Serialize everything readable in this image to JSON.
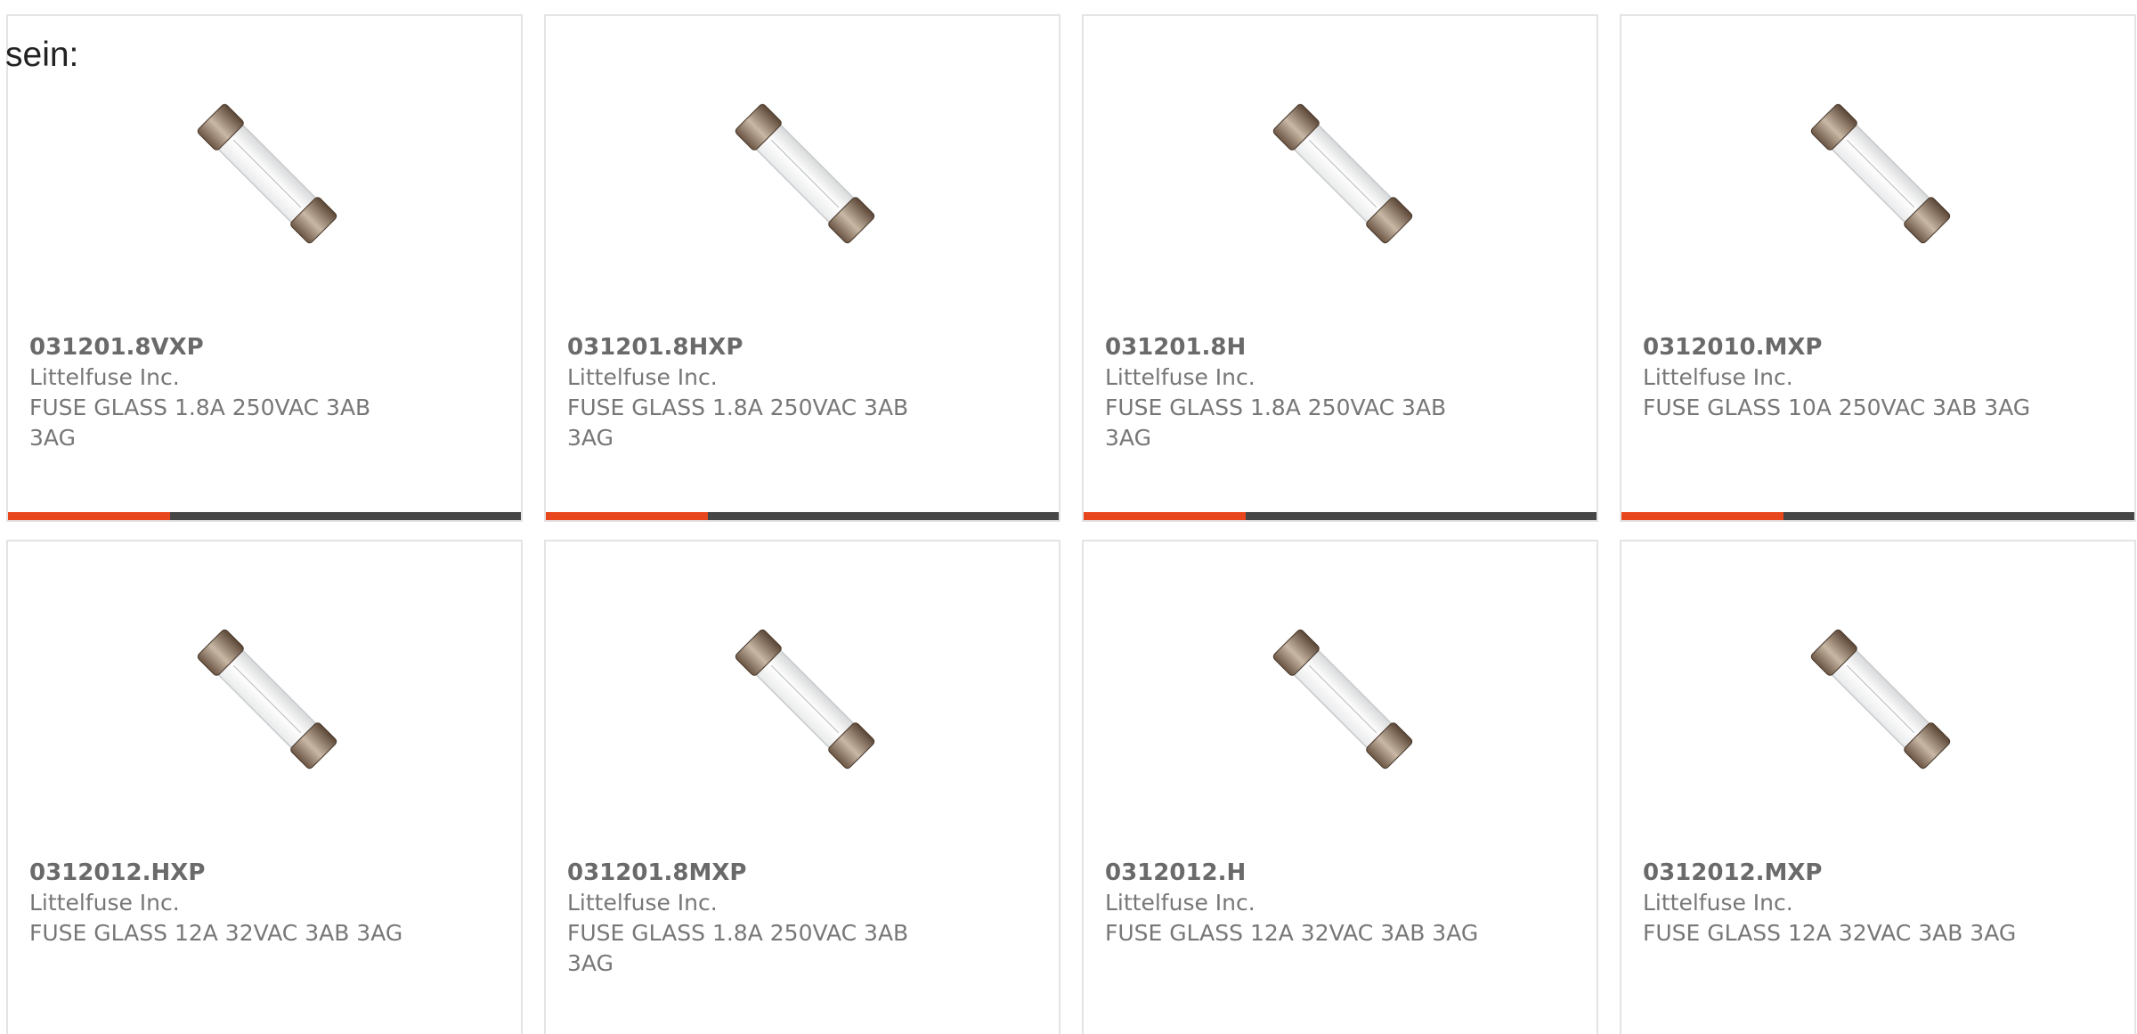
{
  "intro": {
    "label": "sein:"
  },
  "products": [
    {
      "part_number": "031201.8VXP",
      "manufacturer": "Littelfuse Inc.",
      "description": "FUSE GLASS 1.8A 250VAC 3AB 3AG",
      "image_icon": "glass-fuse-icon"
    },
    {
      "part_number": "031201.8HXP",
      "manufacturer": "Littelfuse Inc.",
      "description": "FUSE GLASS 1.8A 250VAC 3AB 3AG",
      "image_icon": "glass-fuse-icon"
    },
    {
      "part_number": "031201.8H",
      "manufacturer": "Littelfuse Inc.",
      "description": "FUSE GLASS 1.8A 250VAC 3AB 3AG",
      "image_icon": "glass-fuse-icon"
    },
    {
      "part_number": "0312010.MXP",
      "manufacturer": "Littelfuse Inc.",
      "description": "FUSE GLASS 10A 250VAC 3AB 3AG",
      "image_icon": "glass-fuse-icon"
    },
    {
      "part_number": "0312012.HXP",
      "manufacturer": "Littelfuse Inc.",
      "description": "FUSE GLASS 12A 32VAC 3AB 3AG",
      "image_icon": "glass-fuse-icon"
    },
    {
      "part_number": "031201.8MXP",
      "manufacturer": "Littelfuse Inc.",
      "description": "FUSE GLASS 1.8A 250VAC 3AB 3AG",
      "image_icon": "glass-fuse-icon"
    },
    {
      "part_number": "0312012.H",
      "manufacturer": "Littelfuse Inc.",
      "description": "FUSE GLASS 12A 32VAC 3AB 3AG",
      "image_icon": "glass-fuse-icon"
    },
    {
      "part_number": "0312012.MXP",
      "manufacturer": "Littelfuse Inc.",
      "description": "FUSE GLASS 12A 32VAC 3AB 3AG",
      "image_icon": "glass-fuse-icon"
    }
  ],
  "colors": {
    "accent": "#e8461d",
    "bar": "#464646",
    "text": "#777777",
    "border": "#e4e4e4"
  }
}
